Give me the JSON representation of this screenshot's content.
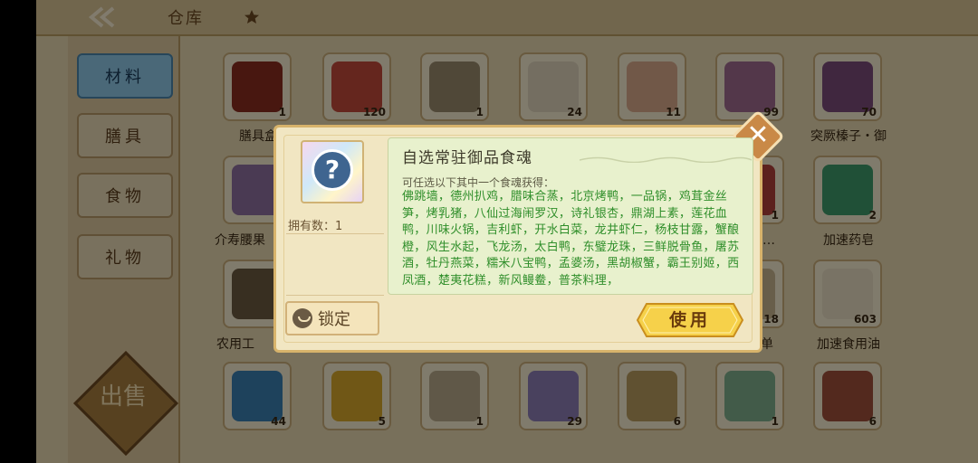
{
  "colors": {
    "accent_blue": "#8ec7e6",
    "dialog_bg": "#f1e6c2",
    "list_green": "#2f8e2a",
    "use_button": "#f6d14a"
  },
  "header": {
    "title": "仓库"
  },
  "sidebar": {
    "items": [
      {
        "label": "材料",
        "active": true
      },
      {
        "label": "膳具"
      },
      {
        "label": "食物"
      },
      {
        "label": "礼物"
      }
    ],
    "emblem": "出售"
  },
  "grid": {
    "row1": [
      {
        "qty": "1",
        "label": "膳具盒"
      },
      {
        "qty": "120",
        "label": ""
      },
      {
        "qty": "1",
        "label": ""
      },
      {
        "qty": "24",
        "label": ""
      },
      {
        "qty": "11",
        "label": ""
      },
      {
        "qty": "99",
        "label": ""
      },
      {
        "qty": "70",
        "label": "突厥榛子・御"
      }
    ],
    "row2": [
      {
        "qty": "",
        "label": "介寿腰果"
      },
      {
        "qty": "1",
        "label": "乙画…"
      },
      {
        "qty": "2",
        "label": "加速药皂"
      }
    ],
    "row3": [
      {
        "qty": "",
        "label": "农用工"
      },
      {
        "qty": "18",
        "label": "单"
      },
      {
        "qty": "603",
        "label": "加速食用油"
      }
    ],
    "row4": [
      {
        "qty": "44"
      },
      {
        "qty": "5"
      },
      {
        "qty": "1"
      },
      {
        "qty": "29"
      },
      {
        "qty": "6"
      },
      {
        "qty": "1"
      },
      {
        "qty": "6"
      }
    ]
  },
  "dialog": {
    "title": "自选常驻御品食魂",
    "owned": "拥有数：1",
    "lock_label": "锁定",
    "use_label": "使用",
    "subtitle": "可任选以下其中一个食魂获得：",
    "options": "佛跳墙，德州扒鸡，腊味合蒸，北京烤鸭，一品锅，鸡茸金丝笋，烤乳猪，八仙过海闹罗汉，诗礼银杏，鼎湖上素，莲花血鸭，川味火锅，吉利虾，开水白菜，龙井虾仁，杨枝甘露，蟹酿橙，风生水起，飞龙汤，太白鸭，东璧龙珠，三鲜脱骨鱼，屠苏酒，牡丹燕菜，糯米八宝鸭，孟婆汤，黑胡椒蟹，霸王别姬，西凤酒，楚夷花糕，新风鳗鲞，普茶料理，"
  }
}
